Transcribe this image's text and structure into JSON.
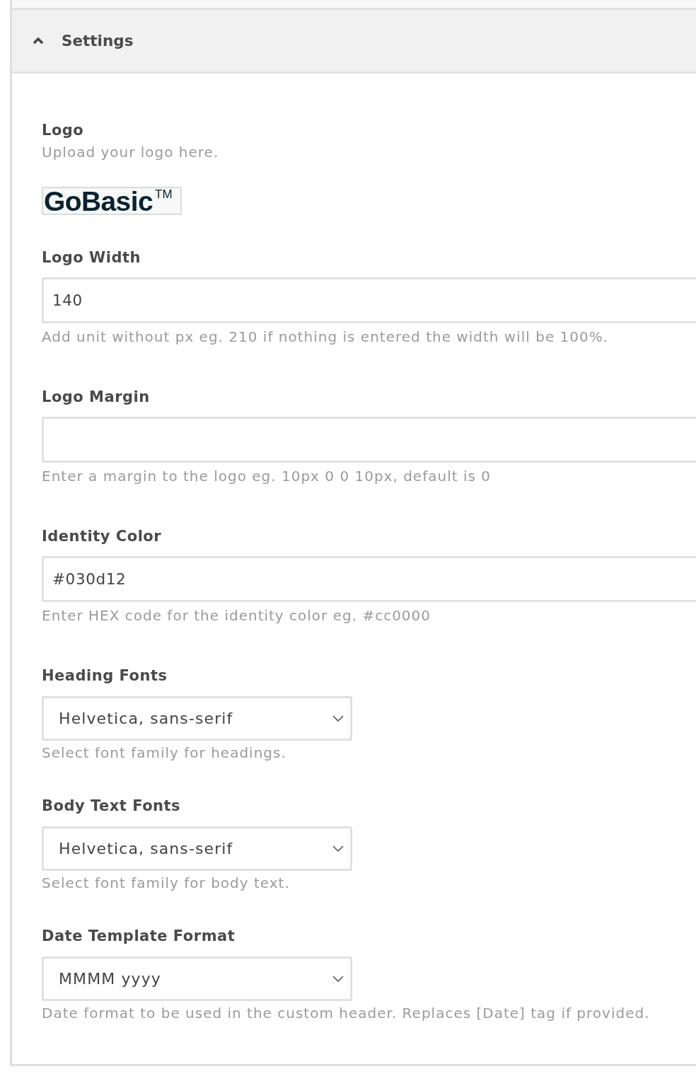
{
  "section": {
    "title": "Settings",
    "expanded": true
  },
  "fields": [
    {
      "kind": "image",
      "label": "Logo",
      "help": "Upload your logo here.",
      "logo": {
        "wordmark": "GoBasic",
        "mark": "TM"
      }
    },
    {
      "kind": "text",
      "label": "Logo Width",
      "value": "140",
      "help": "Add unit without px eg. 210 if nothing is entered the width will be 100%."
    },
    {
      "kind": "text",
      "label": "Logo Margin",
      "help": "Enter a margin to the logo eg. 10px 0 0 10px, default is 0"
    },
    {
      "kind": "text",
      "label": "Identity Color",
      "value": "#030d12",
      "help": "Enter HEX code for the identity color eg. #cc0000"
    },
    {
      "kind": "select",
      "label": "Heading Fonts",
      "value": "Helvetica, sans-serif",
      "help": "Select font family for headings."
    },
    {
      "kind": "select",
      "label": "Body Text Fonts",
      "value": "Helvetica, sans-serif",
      "help": "Select font family for body text."
    },
    {
      "kind": "select",
      "label": "Date Template Format",
      "value": "MMMM yyyy",
      "help": "Date format to be used in the custom header. Replaces [Date] tag if provided."
    }
  ]
}
